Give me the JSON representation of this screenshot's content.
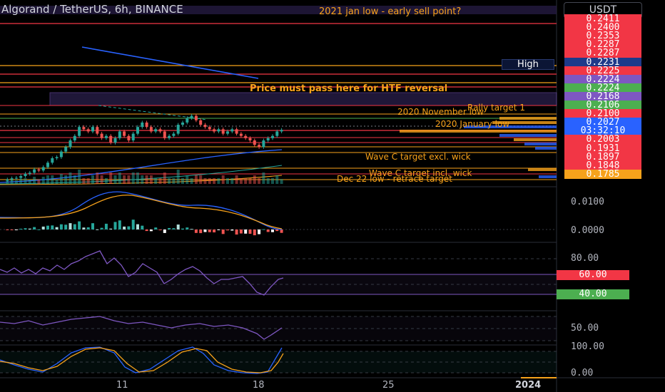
{
  "header": {
    "title": "Algorand / TetherUS, 6h, BINANCE",
    "currency": "USDT",
    "high_tag": "High"
  },
  "price_labels": [
    {
      "text": "0.2411",
      "color": "#f23645"
    },
    {
      "text": "0.2400",
      "color": "#f23645"
    },
    {
      "text": "0.2353",
      "color": "#f23645"
    },
    {
      "text": "0.2287",
      "color": "#f23645"
    },
    {
      "text": "0.2287",
      "color": "#f23645"
    },
    {
      "text": "0.2231",
      "color": "#1e3a8a"
    },
    {
      "text": "0.2225",
      "color": "#f23645"
    },
    {
      "text": "0.2224",
      "color": "#7e57c2"
    },
    {
      "text": "0.2224",
      "color": "#4caf50"
    },
    {
      "text": "0.2168",
      "color": "#7e57c2"
    },
    {
      "text": "0.2106",
      "color": "#4caf50"
    },
    {
      "text": "0.2100",
      "color": "#f23645"
    },
    {
      "text": "0.2027",
      "color": "#2962ff"
    },
    {
      "text": "03:32:10",
      "color": "#2962ff"
    },
    {
      "text": "0.2003",
      "color": "#f23645"
    },
    {
      "text": "0.1931",
      "color": "#f23645"
    },
    {
      "text": "0.1897",
      "color": "#f23645"
    },
    {
      "text": "0.1848",
      "color": "#f23645"
    },
    {
      "text": "0.1785",
      "color": "#f7a21b"
    }
  ],
  "annotations": [
    {
      "text": "2021 jan low - early sell point?",
      "color": "#f7a21b"
    },
    {
      "text": "Price must pass here for HTF reversal",
      "color": "#f7a21b"
    },
    {
      "text": "Rally target 1",
      "color": "#f7a21b"
    },
    {
      "text": "2020 November low",
      "color": "#f7a21b"
    },
    {
      "text": "2020 January low",
      "color": "#f7a21b"
    },
    {
      "text": "Wave C target excl. wick",
      "color": "#f7a21b"
    },
    {
      "text": "Wave C target incl. wick",
      "color": "#f7a21b"
    },
    {
      "text": "Dec 22 low - retrace target",
      "color": "#f7a21b"
    }
  ],
  "indicator_axes": {
    "macd": [
      "0.0100",
      "0.0000"
    ],
    "rsi": [
      "80.00",
      "60.00",
      "40.00"
    ],
    "osc": [
      "50.00"
    ],
    "stoch": [
      "100.00",
      "0.00"
    ]
  },
  "rsi_tags": {
    "upper": "60.00",
    "upper_color": "#f23645",
    "lower": "40.00",
    "lower_color": "#4caf50"
  },
  "x_labels": [
    "11",
    "18",
    "25",
    "2024"
  ],
  "colors": {
    "up": "#26a69a",
    "down": "#ef5350",
    "orange": "#f7a21b",
    "blue": "#2962ff",
    "purple": "#7e57c2"
  },
  "chart_data": {
    "type": "candlestick",
    "title": "Algorand / TetherUS, 6h, BINANCE",
    "price_range": [
      0.1785,
      0.2411
    ],
    "last_price": 0.2027,
    "countdown": "03:32:10",
    "closes": [
      0.18,
      0.1805,
      0.181,
      0.1812,
      0.182,
      0.183,
      0.1835,
      0.185,
      0.1845,
      0.186,
      0.188,
      0.19,
      0.1905,
      0.193,
      0.195,
      0.198,
      0.2,
      0.204,
      0.203,
      0.202,
      0.204,
      0.201,
      0.199,
      0.2,
      0.197,
      0.199,
      0.202,
      0.2,
      0.198,
      0.201,
      0.204,
      0.206,
      0.204,
      0.202,
      0.203,
      0.202,
      0.199,
      0.2,
      0.201,
      0.205,
      0.206,
      0.208,
      0.209,
      0.207,
      0.205,
      0.204,
      0.203,
      0.202,
      0.203,
      0.201,
      0.202,
      0.203,
      0.201,
      0.2,
      0.199,
      0.198,
      0.196,
      0.195,
      0.198,
      0.199,
      0.2,
      0.202,
      0.2027
    ]
  }
}
